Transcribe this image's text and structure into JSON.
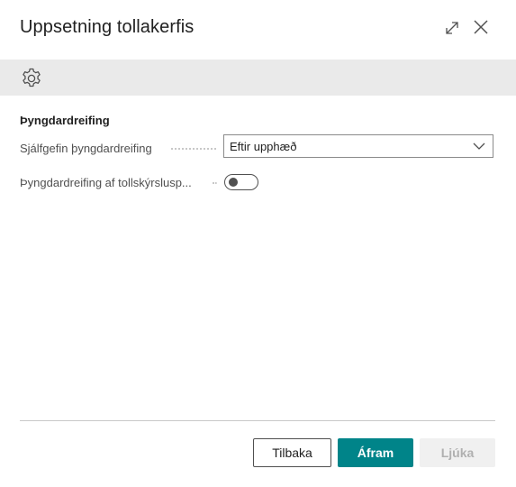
{
  "dialog": {
    "title": "Uppsetning tollakerfis",
    "expand_icon": "expand-diagonal-icon",
    "close_icon": "close-icon"
  },
  "toolbar": {
    "settings_icon": "gear-icon"
  },
  "section": {
    "title": "Þyngdardreifing"
  },
  "fields": {
    "default_distribution": {
      "label": "Sjálfgefin þyngdardreifing",
      "value": "Eftir upphæð"
    },
    "distribution_customs_lines": {
      "label": "Þyngdardreifing af tollskýrslusp...",
      "enabled": false
    }
  },
  "footer": {
    "back_label": "Tilbaka",
    "next_label": "Áfram",
    "finish_label": "Ljúka"
  },
  "colors": {
    "primary": "#008489",
    "toolbar_bg": "#eaeaea",
    "disabled_bg": "#f0f0f0"
  }
}
